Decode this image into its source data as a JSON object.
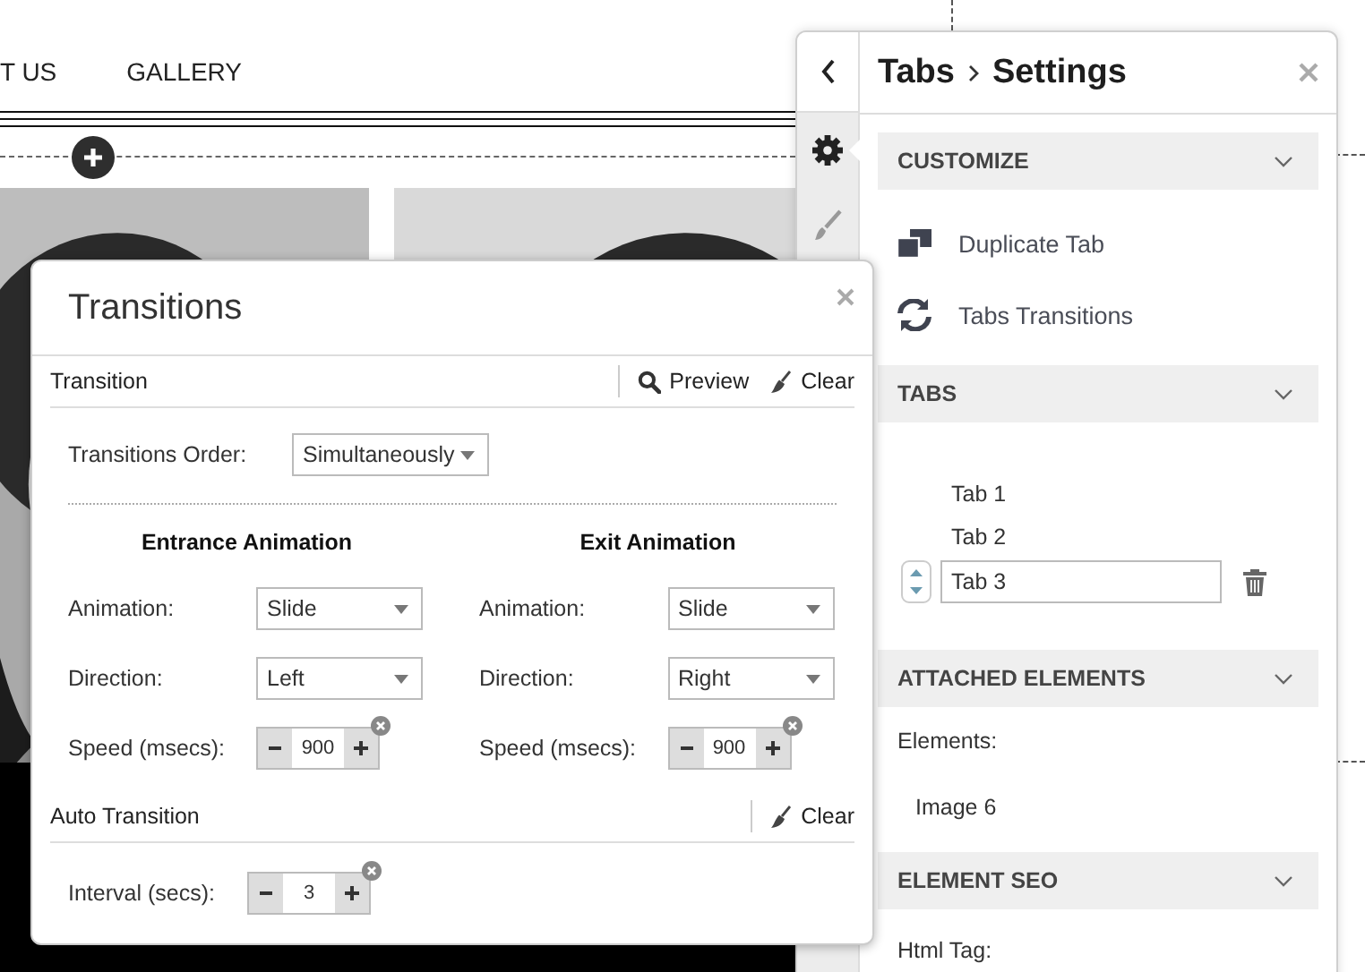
{
  "nav": {
    "items": [
      "T US",
      "GALLERY"
    ]
  },
  "banner": {
    "kind": "dark"
  },
  "settings_panel": {
    "breadcrumb": [
      "Tabs",
      "Settings"
    ],
    "rail": [
      {
        "kind": "settings",
        "selected": true
      },
      {
        "kind": "design",
        "selected": false
      }
    ],
    "sections": [
      {
        "title": "CUSTOMIZE",
        "kind": "actions",
        "items": [
          {
            "kind": "duplicate",
            "label": "Duplicate Tab"
          },
          {
            "kind": "transitions",
            "label": "Tabs Transitions"
          }
        ]
      },
      {
        "title": "TABS",
        "kind": "tabs",
        "tabs": [
          {
            "label": "Tab 1",
            "editing": false
          },
          {
            "label": "Tab 2",
            "editing": false
          },
          {
            "label": "Tab 3",
            "editing": true
          }
        ]
      },
      {
        "title": "ATTACHED ELEMENTS",
        "kind": "elements",
        "label": "Elements:",
        "items": [
          "Image 6"
        ]
      },
      {
        "title": "ELEMENT SEO",
        "kind": "seo",
        "label": "Html Tag:"
      }
    ]
  },
  "transitions_dialog": {
    "title": "Transitions",
    "transition": {
      "header": "Transition",
      "actions": [
        {
          "kind": "preview",
          "label": "Preview"
        },
        {
          "kind": "clear",
          "label": "Clear"
        }
      ],
      "order_label": "Transitions Order:",
      "order_value": "Simultaneously",
      "columns": [
        {
          "heading": "Entrance Animation",
          "fields": [
            {
              "kind": "select",
              "label": "Animation:",
              "value": "Slide"
            },
            {
              "kind": "select",
              "label": "Direction:",
              "value": "Left"
            },
            {
              "kind": "stepper",
              "label": "Speed (msecs):",
              "value": "900"
            }
          ]
        },
        {
          "heading": "Exit Animation",
          "fields": [
            {
              "kind": "select",
              "label": "Animation:",
              "value": "Slide"
            },
            {
              "kind": "select",
              "label": "Direction:",
              "value": "Right"
            },
            {
              "kind": "stepper",
              "label": "Speed (msecs):",
              "value": "900"
            }
          ]
        }
      ]
    },
    "auto": {
      "header": "Auto Transition",
      "actions": [
        {
          "kind": "clear",
          "label": "Clear"
        }
      ],
      "fields": [
        {
          "kind": "stepper",
          "label": "Interval (secs):",
          "value": "3"
        }
      ]
    }
  }
}
